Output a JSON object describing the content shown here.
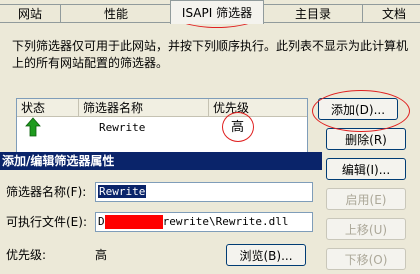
{
  "tabs": [
    "网站",
    "性能",
    "ISAPI 筛选器",
    "主目录",
    "文档"
  ],
  "description": "下列筛选器仅可用于此网站，并按下列顺序执行。此列表不显示为此计算机上的所有网站配置的筛选器。",
  "list": {
    "headers": [
      "状态",
      "筛选器名称",
      "优先级"
    ],
    "rows": [
      {
        "status": "green-up-arrow",
        "name": "Rewrite",
        "priority": "高"
      }
    ]
  },
  "buttons": {
    "add": "添加(D)...",
    "delete": "删除(R)",
    "edit": "编辑(I)...",
    "enable": "启用(E)",
    "move_up": "上移(U)",
    "move_down": "下移(O)",
    "browse": "浏览(B)..."
  },
  "dialog": {
    "title": "添加/编辑筛选器属性",
    "name_label": "筛选器名称(F):",
    "name_value": "Rewrite",
    "exe_label": "可执行文件(E):",
    "exe_value_suffix": "rewrite\\Rewrite.dll",
    "exe_value_prefix": "D",
    "priority_label": "优先级:",
    "priority_value": "高"
  },
  "colors": {
    "annotation": "#e02020",
    "titlebar": "#0a246a"
  }
}
